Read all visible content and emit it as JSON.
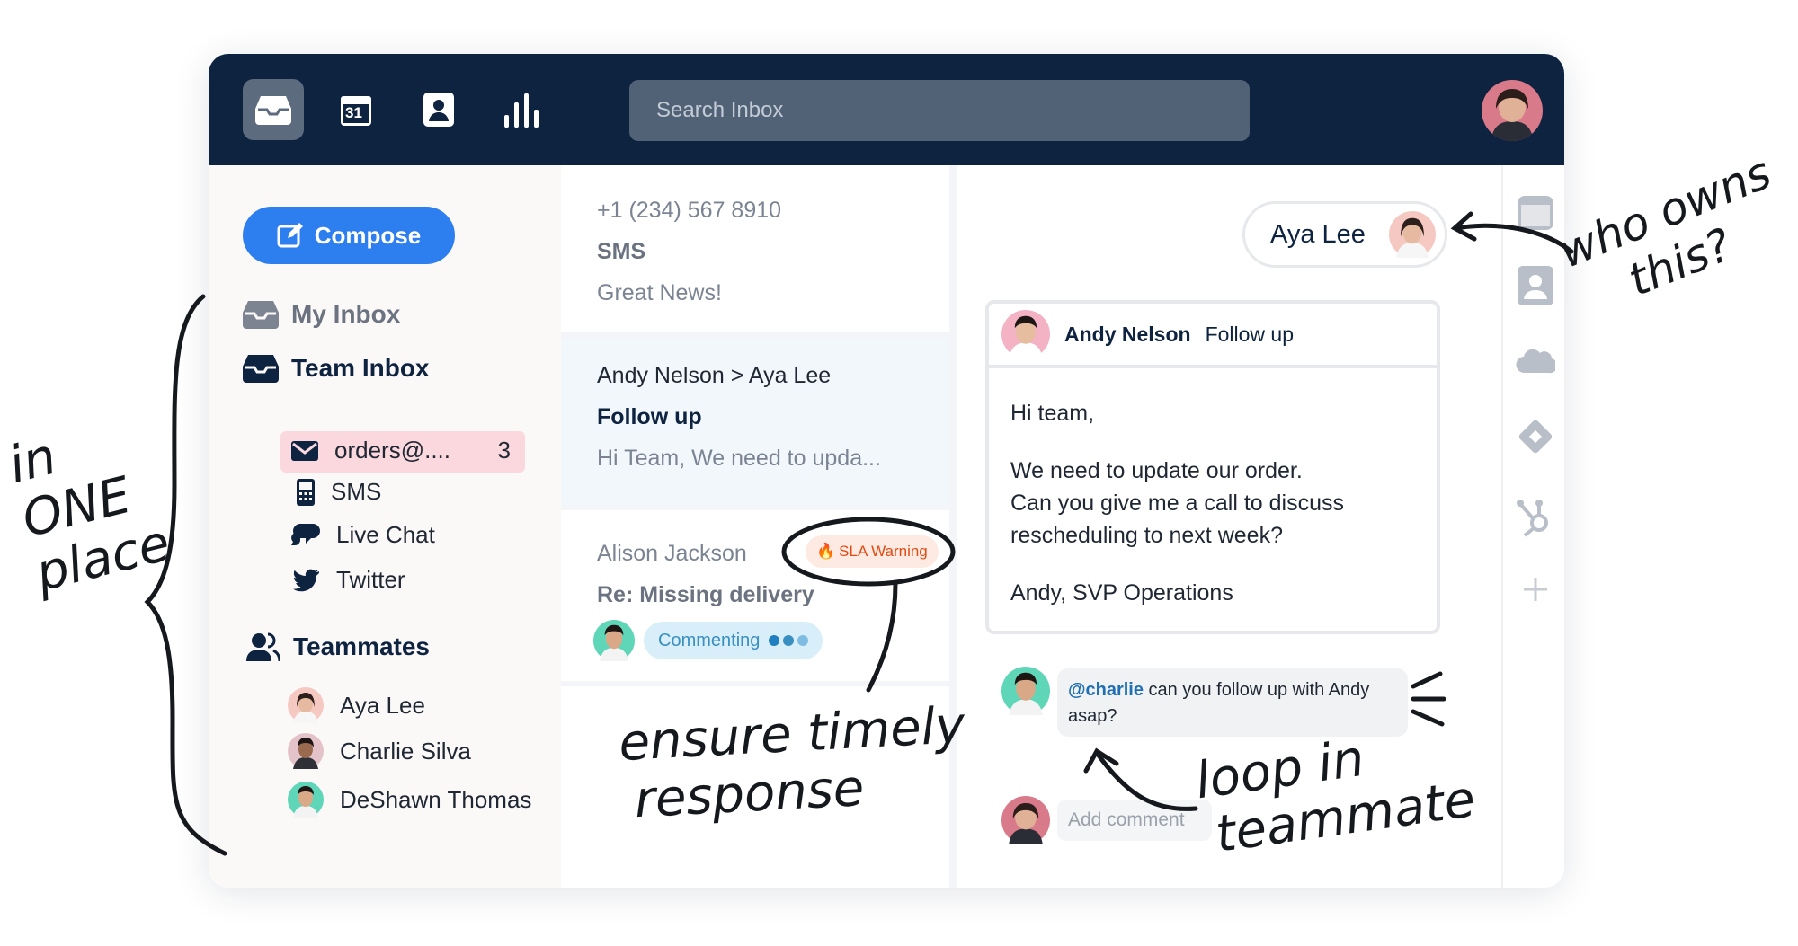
{
  "toolbar": {
    "search_placeholder": "Search Inbox",
    "icons": [
      "inbox-icon",
      "calendar-icon",
      "contacts-icon",
      "analytics-icon"
    ],
    "calendar_day": "31"
  },
  "sidebar": {
    "compose_label": "Compose",
    "my_inbox": "My Inbox",
    "team_inbox": "Team Inbox",
    "channels": [
      {
        "label": "orders@....",
        "count": "3",
        "icon": "envelope-icon"
      },
      {
        "label": "SMS",
        "icon": "phone-icon"
      },
      {
        "label": "Live Chat",
        "icon": "chat-bubbles-icon"
      },
      {
        "label": "Twitter",
        "icon": "twitter-bird-icon"
      }
    ],
    "teammates_heading": "Teammates",
    "teammates": [
      {
        "name": "Aya Lee"
      },
      {
        "name": "Charlie Silva"
      },
      {
        "name": "DeShawn Thomas"
      }
    ]
  },
  "conversations": [
    {
      "from": "+1 (234) 567 8910",
      "subject": "SMS",
      "preview": "Great News!"
    },
    {
      "from": "Andy Nelson > Aya Lee",
      "subject": "Follow up",
      "preview": "Hi Team, We need to upda..."
    },
    {
      "from": "Alison Jackson",
      "subject": "Re: Missing delivery",
      "badge": "SLA Warning",
      "status": "Commenting"
    }
  ],
  "detail": {
    "assignee": "Aya Lee",
    "sender": "Andy Nelson",
    "subject": "Follow up",
    "body": {
      "greeting": "Hi team,",
      "line1": "We need to update our order.",
      "line2": "Can you give me a call to discuss",
      "line3": "rescheduling to next week?",
      "signoff": "Andy, SVP Operations"
    },
    "comment": {
      "mention": "@charlie",
      "text_line1": " can you follow up with Andy",
      "text_line2": "asap?"
    },
    "add_comment_placeholder": "Add comment"
  },
  "rightbar_icons": [
    "calendar-app-icon",
    "contact-card-icon",
    "salesforce-cloud-icon",
    "jira-diamond-icon",
    "hubspot-icon",
    "add-integration-icon"
  ],
  "annotations": {
    "left": [
      "in",
      "ONE",
      "place"
    ],
    "sla": [
      "ensure timely",
      "response"
    ],
    "owner": [
      "who owns",
      "this?"
    ],
    "comment": [
      "loop in",
      "teammate"
    ]
  },
  "colors": {
    "topbar": "#0e2340",
    "accent": "#2d7ff0",
    "selected_row": "#fbd8de",
    "sla_badge": "#fdebe3",
    "sla_text": "#e24a12",
    "commenting": "#d8effa"
  }
}
